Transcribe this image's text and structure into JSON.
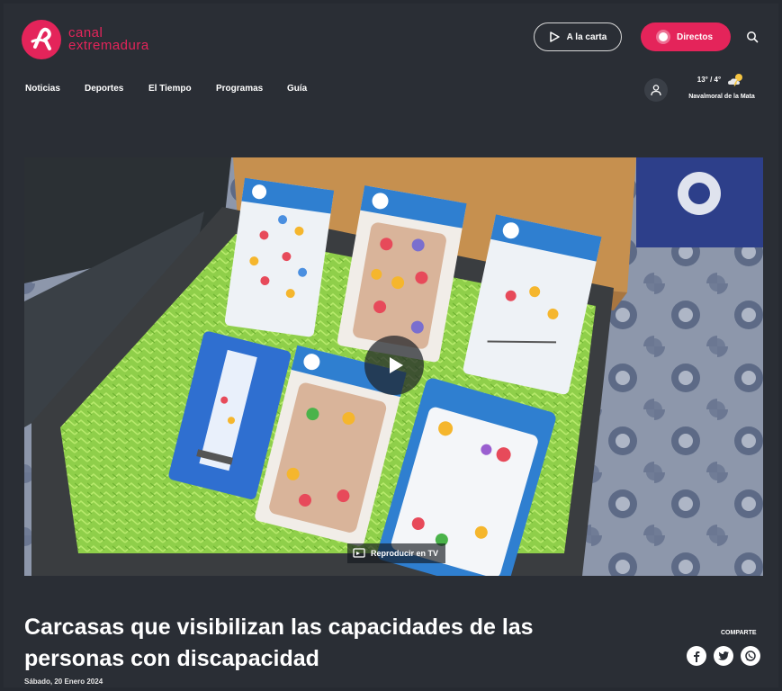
{
  "header": {
    "logo_line1": "canal",
    "logo_line2": "extremadura",
    "alacarta_label": "A la carta",
    "directos_label": "Directos"
  },
  "nav": {
    "items": [
      "Noticias",
      "Deportes",
      "El Tiempo",
      "Programas",
      "Guía"
    ]
  },
  "weather": {
    "temps": "13° / 4°",
    "location": "Navalmoral de la Mata"
  },
  "video": {
    "tv_label": "Reproducir en TV"
  },
  "article": {
    "title": "Carcasas que visibilizan las capacidades de las personas con discapacidad",
    "date": "Sábado, 20 Enero 2024"
  },
  "share": {
    "label": "COMPARTE"
  },
  "colors": {
    "brand": "#e4245a",
    "background": "#2a2e35"
  },
  "icons": [
    "play-icon",
    "search-icon",
    "user-icon",
    "weather-icon",
    "facebook-icon",
    "twitter-icon",
    "whatsapp-icon",
    "tv-icon"
  ]
}
